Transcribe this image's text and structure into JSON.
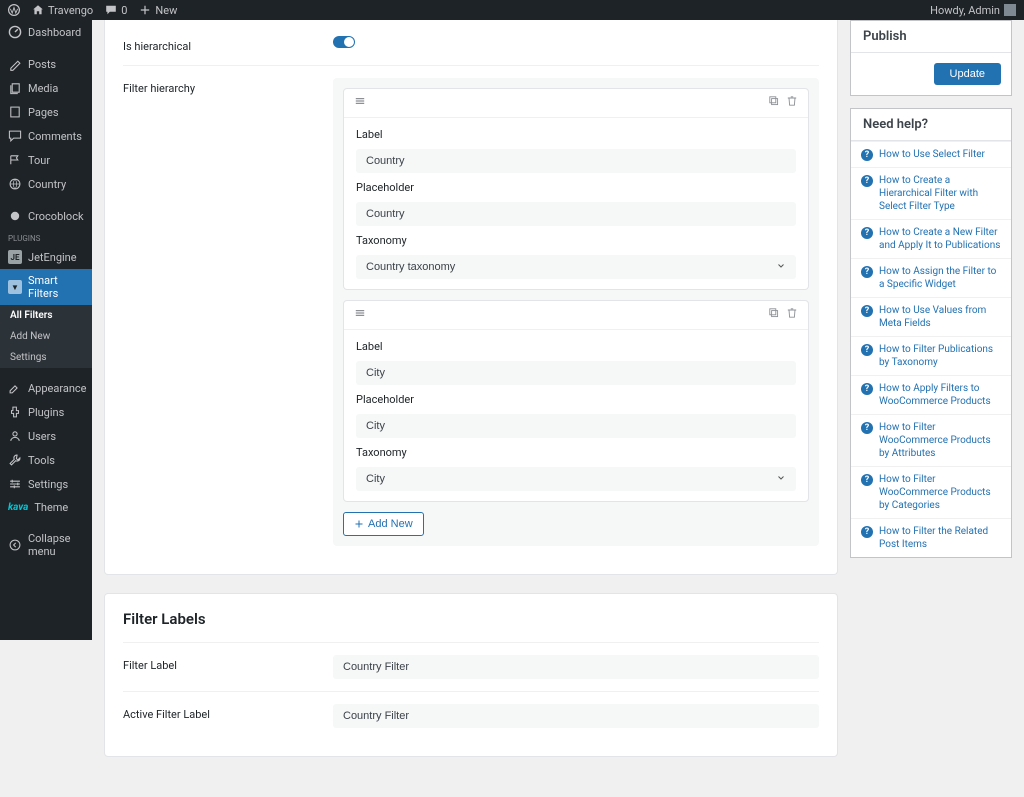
{
  "adminbar": {
    "site": "Travengo",
    "comments": "0",
    "new": "New",
    "greeting": "Howdy, Admin"
  },
  "sidebar": {
    "dashboard": "Dashboard",
    "posts": "Posts",
    "media": "Media",
    "pages": "Pages",
    "comments": "Comments",
    "tour": "Tour",
    "country": "Country",
    "crocoblock": "Crocoblock",
    "jetengine": "JetEngine",
    "smart_filters": "Smart Filters",
    "sub_all": "All Filters",
    "sub_add": "Add New",
    "sub_settings": "Settings",
    "appearance": "Appearance",
    "plugins": "Plugins",
    "users": "Users",
    "tools": "Tools",
    "settings": "Settings",
    "theme": "Theme",
    "collapse": "Collapse menu",
    "plugins_group": "Plugins"
  },
  "main": {
    "is_hierarchical": "Is hierarchical",
    "filter_hierarchy": "Filter hierarchy",
    "labels_title": "Filter Labels",
    "filter_label_lbl": "Filter Label",
    "filter_label_val": "Country Filter",
    "active_filter_lbl": "Active Filter Label",
    "active_filter_val": "Country Filter",
    "add_new": "Add New"
  },
  "hierarchy": [
    {
      "label_lbl": "Label",
      "label_val": "Country",
      "ph_lbl": "Placeholder",
      "ph_val": "Country",
      "tax_lbl": "Taxonomy",
      "tax_val": "Country taxonomy"
    },
    {
      "label_lbl": "Label",
      "label_val": "City",
      "ph_lbl": "Placeholder",
      "ph_val": "City",
      "tax_lbl": "Taxonomy",
      "tax_val": "City"
    }
  ],
  "publish": {
    "title": "Publish",
    "button": "Update"
  },
  "help": {
    "title": "Need help?",
    "links": [
      "How to Use Select Filter",
      "How to Create a Hierarchical Filter with Select Filter Type",
      "How to Create a New Filter and Apply It to Publications",
      "How to Assign the Filter to a Specific Widget",
      "How to Use Values from Meta Fields",
      "How to Filter Publications by Taxonomy",
      "How to Apply Filters to WooCommerce Products",
      "How to Filter WooCommerce Products by Attributes",
      "How to Filter WooCommerce Products by Categories",
      "How to Filter the Related Post Items"
    ]
  }
}
